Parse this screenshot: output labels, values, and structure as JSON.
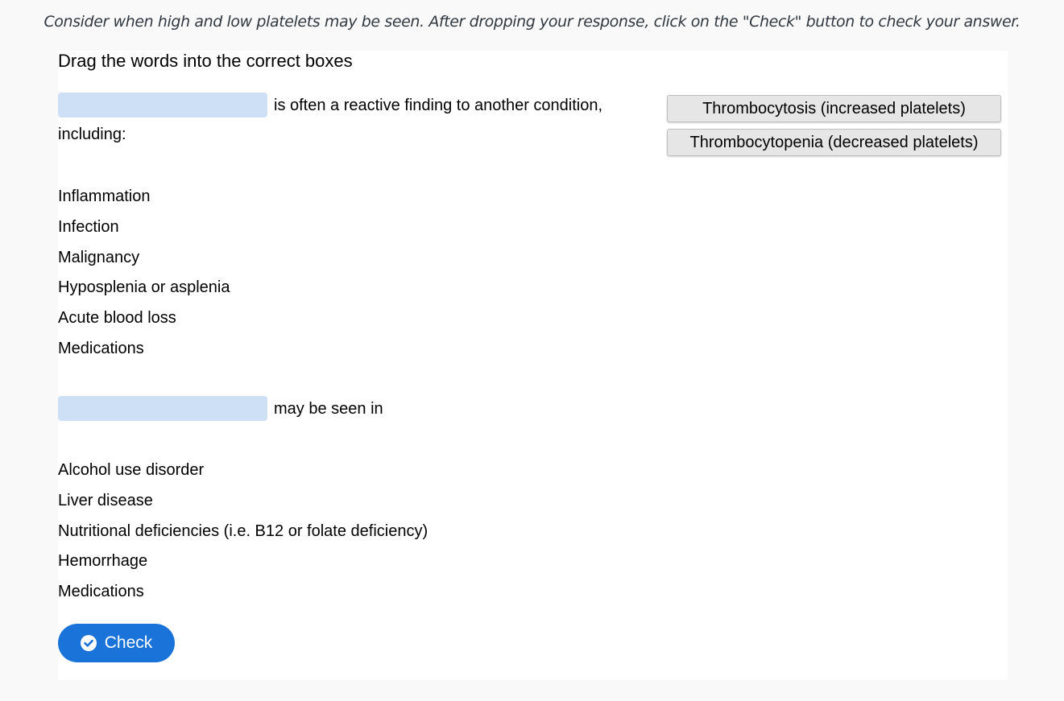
{
  "instruction": "Consider when high and low platelets may be seen. After dropping your response, click on the \"Check\" button to check your answer.",
  "heading": "Drag the words into the correct boxes",
  "section1": {
    "sentence_part1": "is often a reactive finding to another condition,",
    "sentence_part2": "including:",
    "items": [
      "Inflammation",
      "Infection",
      "Malignancy",
      "Hyposplenia or asplenia",
      "Acute blood loss",
      "Medications"
    ]
  },
  "section2": {
    "sentence": "may be seen in",
    "items": [
      "Alcohol use disorder",
      "Liver disease",
      "Nutritional deficiencies (i.e. B12 or folate deficiency)",
      "Hemorrhage",
      "Medications"
    ]
  },
  "word_bank": [
    "Thrombocytosis (increased platelets)",
    "Thrombocytopenia (decreased platelets)"
  ],
  "check_button": {
    "label": "Check",
    "icon": "check-circle-icon"
  },
  "colors": {
    "dropzone": "#cde0f5",
    "button": "#1a73d9",
    "chip": "#e6e6e6",
    "background": "#f9f9f9"
  }
}
